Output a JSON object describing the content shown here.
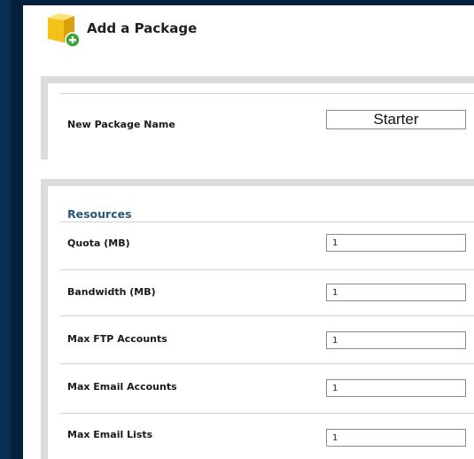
{
  "header": {
    "title": "Add a Package",
    "icon": "add-package-icon"
  },
  "package": {
    "name_label": "New Package Name",
    "name_value": "Starter"
  },
  "resources": {
    "heading": "Resources",
    "rows": [
      {
        "label": "Quota (MB)",
        "value": "1"
      },
      {
        "label": "Bandwidth (MB)",
        "value": "1"
      },
      {
        "label": "Max FTP Accounts",
        "value": "1"
      },
      {
        "label": "Max Email Accounts",
        "value": "1"
      },
      {
        "label": "Max Email Lists",
        "value": "1"
      }
    ]
  },
  "colors": {
    "background": "#0b2f52",
    "section_border": "#dcdcdc",
    "resources_heading": "#1f5a7a",
    "icon_box": "#f2c21a",
    "icon_plus": "#3aa63a"
  }
}
